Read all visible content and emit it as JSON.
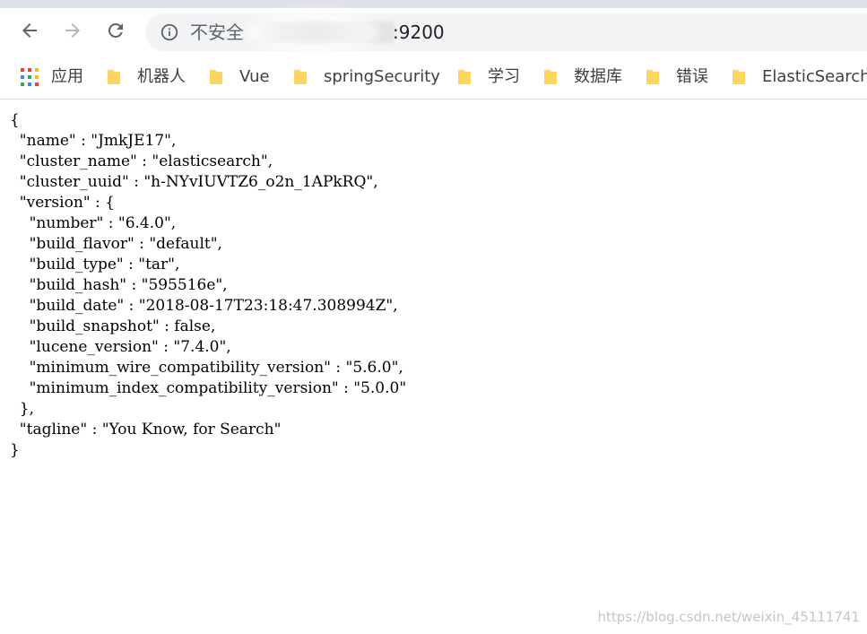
{
  "toolbar": {
    "back_icon": "arrow-back-icon",
    "forward_icon": "arrow-forward-icon",
    "reload_icon": "reload-icon",
    "security_label": "不安全",
    "url_port": ":9200"
  },
  "bookmarks": {
    "apps_label": "应用",
    "items": [
      "机器人",
      "Vue",
      "springSecurity",
      "学习",
      "数据库",
      "错误",
      "ElasticSearch"
    ]
  },
  "json_lines": [
    "{",
    "  \"name\" : \"JmkJE17\",",
    "  \"cluster_name\" : \"elasticsearch\",",
    "  \"cluster_uuid\" : \"h-NYvIUVTZ6_o2n_1APkRQ\",",
    "  \"version\" : {",
    "    \"number\" : \"6.4.0\",",
    "    \"build_flavor\" : \"default\",",
    "    \"build_type\" : \"tar\",",
    "    \"build_hash\" : \"595516e\",",
    "    \"build_date\" : \"2018-08-17T23:18:47.308994Z\",",
    "    \"build_snapshot\" : false,",
    "    \"lucene_version\" : \"7.4.0\",",
    "    \"minimum_wire_compatibility_version\" : \"5.6.0\",",
    "    \"minimum_index_compatibility_version\" : \"5.0.0\"",
    "  },",
    "  \"tagline\" : \"You Know, for Search\"",
    "}"
  ],
  "watermark": "https://blog.csdn.net/weixin_45111741",
  "colors": {
    "folder": "#fcd663",
    "omnibox_bg": "#f1f3f4",
    "icon": "#5f6368"
  }
}
